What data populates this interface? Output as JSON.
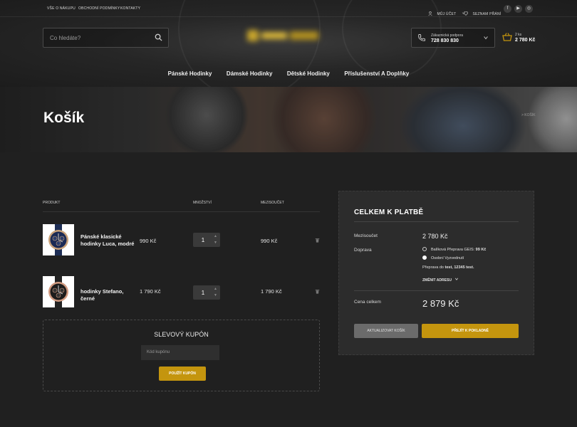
{
  "colors": {
    "accent": "#c4950e",
    "background": "#202020",
    "panel": "#2c2c2c"
  },
  "topbar": {
    "links": [
      "VŠE O NÁKUPU",
      "OBCHODNÍ PODMÍNKY",
      "KONTAKTY"
    ],
    "account": "MŮJ ÚČET",
    "wishlist": "SEZNAM PŘÁNÍ",
    "social_icons": [
      "facebook-icon",
      "youtube-icon",
      "instagram-icon"
    ]
  },
  "header": {
    "search_placeholder": "Co hledáte?",
    "support_label": "Zákaznická podpora",
    "support_phone": "728 830 830",
    "cart_count": "2 ks",
    "cart_total": "2 780 Kč"
  },
  "nav": [
    "Pánské Hodinky",
    "Dámské Hodinky",
    "Dětské Hodinky",
    "Příslušenství A Doplňky"
  ],
  "page": {
    "title": "Košík",
    "breadcrumb": "> KOŠÍK"
  },
  "table": {
    "headers": {
      "product": "PRODUKT",
      "quantity": "MNOŽSTVÍ",
      "subtotal": "MEZISOUČET"
    },
    "rows": [
      {
        "name": "Pánské klasické hodinky Luca, modré",
        "price": "990 Kč",
        "qty": "1",
        "subtotal": "990 Kč"
      },
      {
        "name": "hodinky Stefano, černé",
        "price": "1 790 Kč",
        "qty": "1",
        "subtotal": "1 790 Kč"
      }
    ]
  },
  "coupon": {
    "title": "SLEVOVÝ KUPÓN",
    "placeholder": "Kód kupónu",
    "button": "POUŽÍT KUPÓN"
  },
  "totals": {
    "title": "CELKEM K PLATBĚ",
    "subtotal_label": "Mezisoučet",
    "subtotal_value": "2 780 Kč",
    "shipping_label": "Doprava",
    "options": [
      {
        "label": "Balíková Přeprava GEIS:",
        "price": "99 Kč",
        "selected": false
      },
      {
        "label": "Osobní Vyzvednutí",
        "price": "",
        "selected": true
      }
    ],
    "shipping_to_prefix": "Přeprava do",
    "shipping_to_value": "test, 12345 test",
    "change_address": "ZMĚNIT ADRESU",
    "total_label": "Cena celkem",
    "total_value": "2 879 Kč",
    "update_button": "AKTUALIZOVAT KOŠÍK",
    "checkout_button": "PŘEJÍT K POKLADNĚ"
  }
}
